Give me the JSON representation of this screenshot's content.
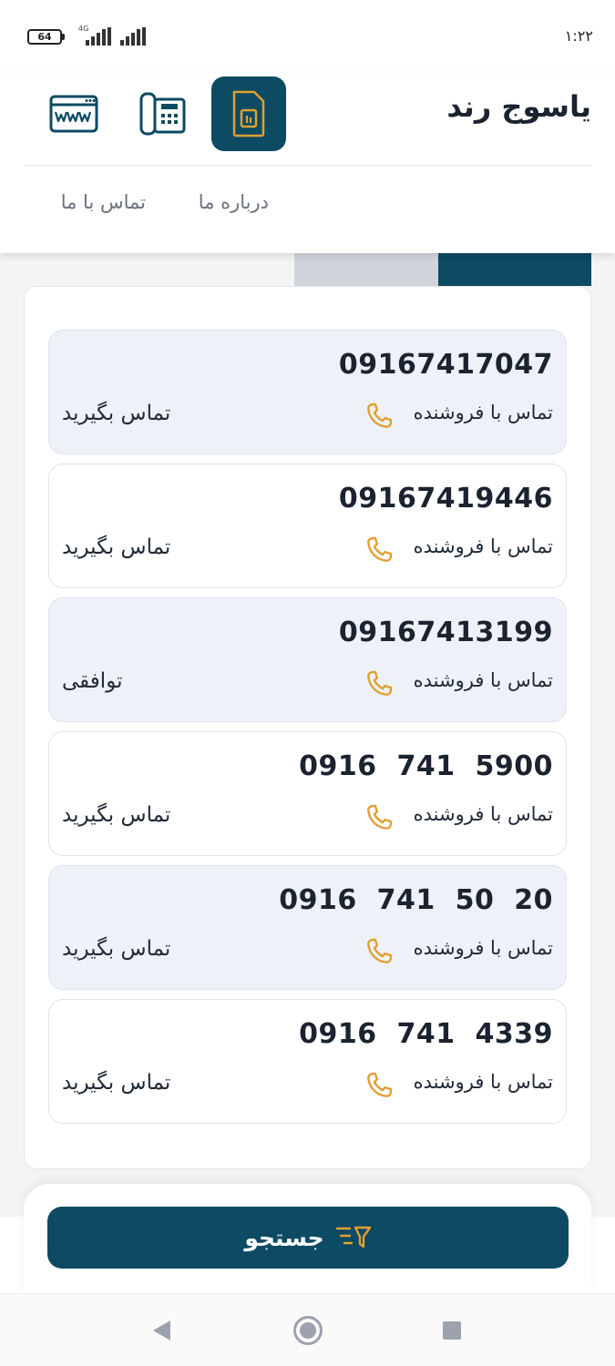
{
  "status_bar": {
    "battery": "64",
    "network": "4G",
    "time": "۱:۲۲"
  },
  "header": {
    "brand": "یاسوج رند",
    "nav_links": [
      "درباره ما",
      "تماس با ما"
    ],
    "category_icons": [
      "sim-card-icon",
      "landline-phone-icon",
      "domain-www-icon"
    ]
  },
  "listings": [
    {
      "number": "09167417047",
      "seller_label": "تماس با فروشنده",
      "price": "تماس بگیرید"
    },
    {
      "number": "09167419446",
      "seller_label": "تماس با فروشنده",
      "price": "تماس بگیرید"
    },
    {
      "number": "09167413199",
      "seller_label": "تماس با فروشنده",
      "price": "توافقی"
    },
    {
      "number": "0916  741  5900",
      "seller_label": "تماس با فروشنده",
      "price": "تماس بگیرید"
    },
    {
      "number": "0916  741  50  20",
      "seller_label": "تماس با فروشنده",
      "price": "تماس بگیرید"
    },
    {
      "number": "0916  741  4339",
      "seller_label": "تماس با فروشنده",
      "price": "تماس بگیرید"
    }
  ],
  "search": {
    "label": "جستجو"
  },
  "colors": {
    "primary": "#0d4a63",
    "accent": "#e0a030",
    "card_shade": "#eef2f8"
  }
}
